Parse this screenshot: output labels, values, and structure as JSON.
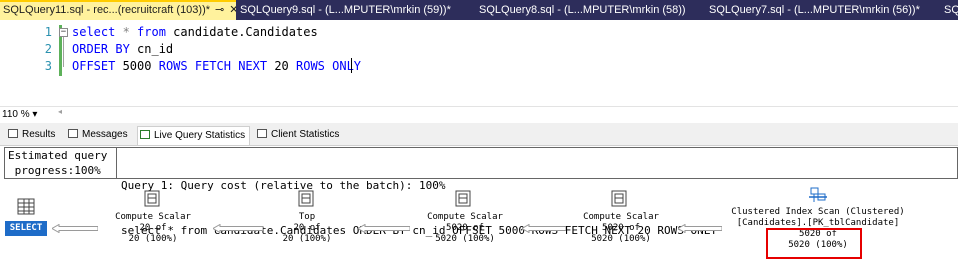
{
  "tabs": [
    {
      "label": "SQLQuery11.sql - rec...(recruitcraft (103))*",
      "active": true
    },
    {
      "label": "SQLQuery9.sql - (L...MPUTER\\mrkin (59))*",
      "active": false
    },
    {
      "label": "SQLQuery8.sql - (L...MPUTER\\mrkin (58))",
      "active": false
    },
    {
      "label": "SQLQuery7.sql - (L...MPUTER\\mrkin (56))*",
      "active": false
    },
    {
      "label": "SQ",
      "active": false
    }
  ],
  "tab_icons": {
    "pin": "⊸",
    "close": "✕"
  },
  "editor": {
    "line_numbers": [
      "1",
      "2",
      "3"
    ],
    "line1": {
      "kw1": "select",
      "star": " * ",
      "kw2": "from",
      "rest": " candidate.Candidates"
    },
    "line2": {
      "kw1": "ORDER BY",
      "rest": " cn_id"
    },
    "line3": {
      "kw1": "OFFSET",
      "n1": " 5000 ",
      "kw2": "ROWS FETCH NEXT",
      "n2": " 20 ",
      "kw3": "ROWS ONLY"
    }
  },
  "zoom": {
    "value": "110 %",
    "arrow": "▾",
    "scroll_left": "◂"
  },
  "result_tabs": [
    "Results",
    "Messages",
    "Live Query Statistics",
    "Client Statistics"
  ],
  "estimate": {
    "line1": "Estimated query",
    "line2": " progress:100%"
  },
  "query_info": {
    "line1": "Query 1: Query cost (relative to the batch): 100%",
    "line2": "select * from candidate.Candidates ORDER BY cn_id OFFSET 5000 ROWS FETCH NEXT 20 ROWS ONLY"
  },
  "plan_nodes": [
    {
      "name": "SELECT"
    },
    {
      "name": "Compute Scalar",
      "rows": "20 of",
      "pct": "20 (100%)"
    },
    {
      "name": "Top",
      "rows": "20 of",
      "pct": "20 (100%)"
    },
    {
      "name": "Compute Scalar",
      "rows": "5020 of",
      "pct": "5020 (100%)"
    },
    {
      "name": "Compute Scalar",
      "rows": "5020 of",
      "pct": "5020 (100%)"
    },
    {
      "name": "Clustered Index Scan (Clustered)",
      "object": "[Candidates].[PK_tblCandidate]",
      "rows": "5020 of",
      "pct": "5020 (100%)"
    }
  ],
  "colors": {
    "accent": "#fff29d",
    "tabstrip": "#2d2d5b",
    "select_node": "#1e6cc8",
    "highlight": "#e60000"
  }
}
